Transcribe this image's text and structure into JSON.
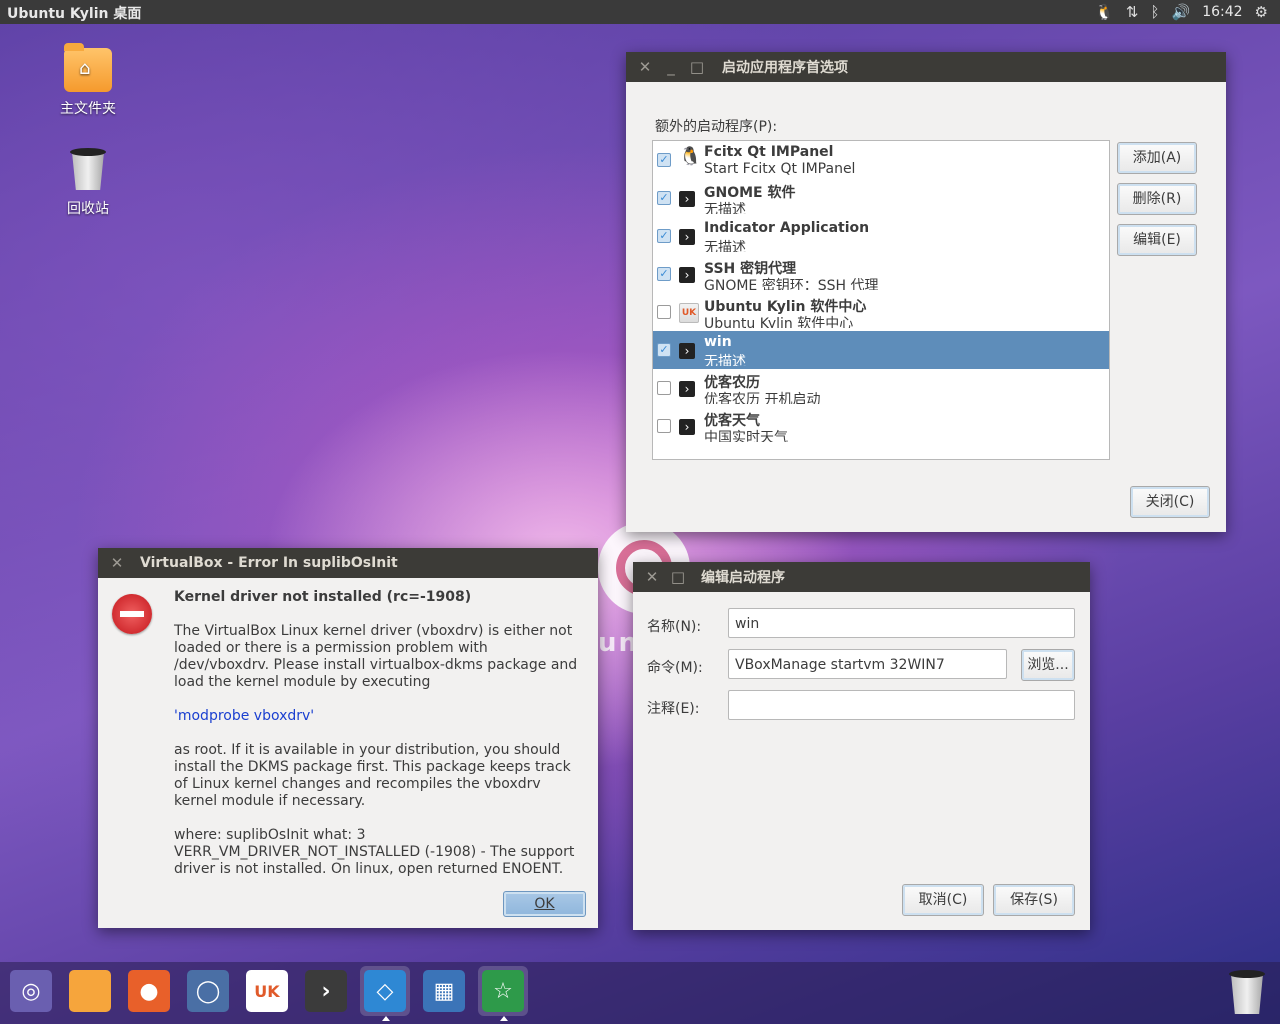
{
  "top_panel": {
    "title": "Ubuntu Kylin 桌面",
    "clock": "16:42",
    "tray_icons": [
      "qq-penguin-icon",
      "network-icon",
      "bluetooth-icon",
      "volume-icon",
      "gear-icon"
    ]
  },
  "desktop": {
    "icons": [
      {
        "label": "主文件夹",
        "icon": "home-folder-icon"
      },
      {
        "label": "回收站",
        "icon": "trash-icon"
      }
    ],
    "wallpaper_text": "unt"
  },
  "startup_prefs": {
    "title": "启动应用程序首选项",
    "list_label": "额外的启动程序(P):",
    "items": [
      {
        "name": "Fcitx Qt IMPanel",
        "desc": "Start Fcitx Qt IMPanel",
        "checked": true,
        "icon": "penguin-icon"
      },
      {
        "name": "GNOME 软件",
        "desc": "无描述",
        "checked": true,
        "icon": "terminal-icon"
      },
      {
        "name": "Indicator Application",
        "desc": "无描述",
        "checked": true,
        "icon": "terminal-icon"
      },
      {
        "name": "SSH 密钥代理",
        "desc": "GNOME 密钥环：SSH 代理",
        "checked": true,
        "icon": "terminal-icon"
      },
      {
        "name": "Ubuntu Kylin 软件中心",
        "desc": "Ubuntu Kylin 软件中心",
        "checked": false,
        "icon": "uk-software-center-icon"
      },
      {
        "name": "win",
        "desc": "无描述",
        "checked": true,
        "icon": "terminal-icon",
        "selected": true
      },
      {
        "name": "优客农历",
        "desc": "优客农历 开机启动",
        "checked": false,
        "icon": "terminal-icon"
      },
      {
        "name": "优客天气",
        "desc": "中国实时天气",
        "checked": false,
        "icon": "terminal-icon"
      }
    ],
    "add_button": "添加(A)",
    "remove_button": "删除(R)",
    "edit_button": "编辑(E)",
    "close_button": "关闭(C)"
  },
  "error_dialog": {
    "title": "VirtualBox - Error In suplibOsInit",
    "heading": "Kernel driver not installed (rc=-1908)",
    "para1": "The VirtualBox Linux kernel driver (vboxdrv) is either not loaded or there is a permission problem with /dev/vboxdrv. Please install virtualbox-dkms package and load the kernel module by executing",
    "command": "'modprobe vboxdrv'",
    "para2": "as root. If it is available in your distribution, you should install the DKMS package first. This package keeps track of Linux kernel changes and recompiles the vboxdrv kernel module if necessary.",
    "para3": "where: suplibOsInit what: 3 VERR_VM_DRIVER_NOT_INSTALLED (-1908) - The support driver is not installed. On linux, open returned ENOENT.",
    "ok_button": "OK"
  },
  "edit_startup": {
    "title": "编辑启动程序",
    "name_label": "名称(N):",
    "name_value": "win",
    "command_label": "命令(M):",
    "command_value": "VBoxManage startvm 32WIN7",
    "browse_button": "浏览...",
    "comment_label": "注释(E):",
    "comment_value": "",
    "cancel_button": "取消(C)",
    "save_button": "保存(S)"
  },
  "launcher": {
    "uk_badge": "UK",
    "items": [
      {
        "name": "ubuntu-dash",
        "color": "#6a5fb0"
      },
      {
        "name": "files",
        "color": "#f6a53c"
      },
      {
        "name": "firefox",
        "color": "#e8602a"
      },
      {
        "name": "chromium",
        "color": "#4a6fa5"
      },
      {
        "name": "uk-software-center",
        "color": "#ffffff"
      },
      {
        "name": "terminal",
        "color": "#3b3b3b"
      },
      {
        "name": "startup-apps",
        "color": "#2e88d4"
      },
      {
        "name": "workspace-switcher",
        "color": "#3b74b8"
      },
      {
        "name": "favorites",
        "color": "#2e9a4a"
      }
    ]
  }
}
